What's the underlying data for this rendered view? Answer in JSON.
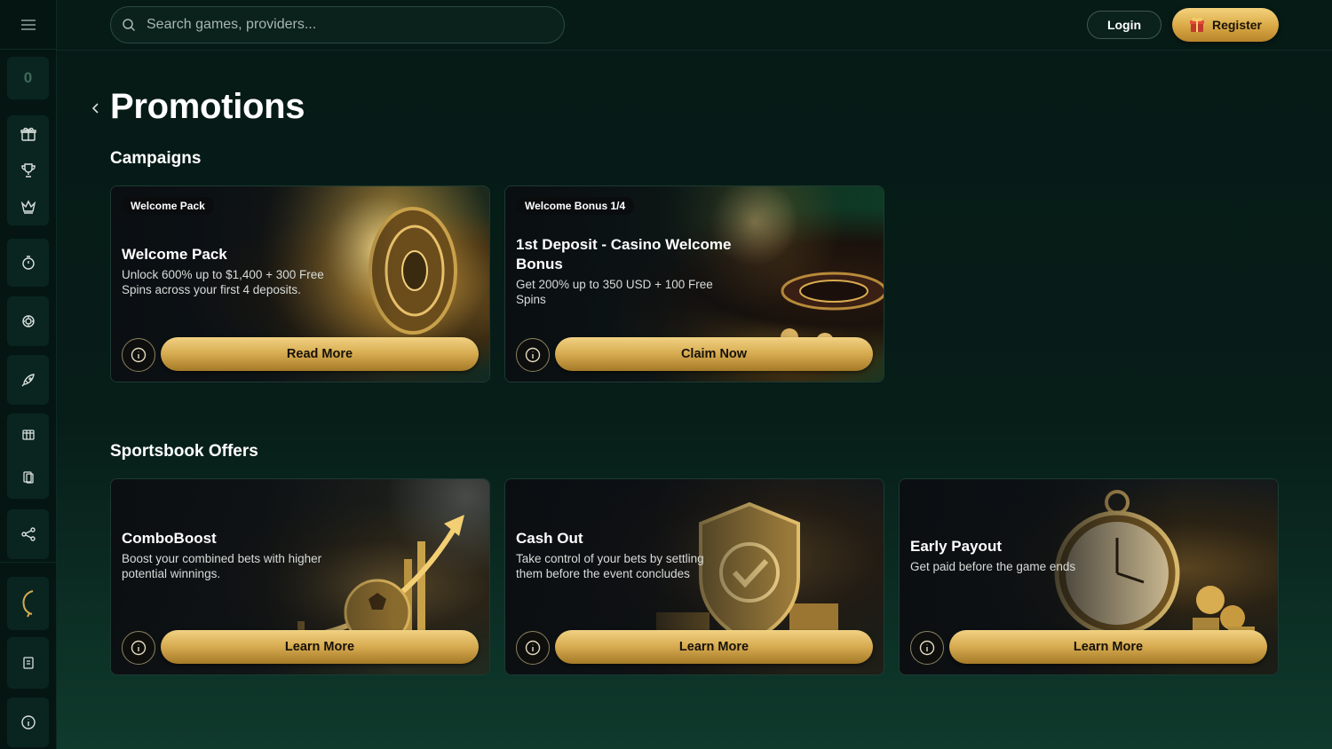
{
  "search": {
    "placeholder": "Search games, providers..."
  },
  "header": {
    "login_label": "Login",
    "register_label": "Register"
  },
  "sidebar": {
    "balance": "0"
  },
  "page": {
    "title": "Promotions"
  },
  "sections": {
    "campaigns": {
      "title": "Campaigns",
      "cards": [
        {
          "badge": "Welcome Pack",
          "title": "Welcome Pack",
          "description": "Unlock 600% up to $1,400 + 300 Free Spins across your first 4 deposits.",
          "cta": "Read More"
        },
        {
          "badge": "Welcome Bonus 1/4",
          "title": "1st Deposit - Casino Welcome Bonus",
          "description": "Get 200% up to 350 USD + 100 Free Spins",
          "cta": "Claim Now"
        }
      ]
    },
    "sportsbook": {
      "title": "Sportsbook Offers",
      "cards": [
        {
          "title": "ComboBoost",
          "description": "Boost your combined bets with higher potential winnings.",
          "cta": "Learn More"
        },
        {
          "title": "Cash Out",
          "description": "Take control of your bets by settling them before the event concludes",
          "cta": "Learn More"
        },
        {
          "title": "Early Payout",
          "description": "Get paid before the game ends",
          "cta": "Learn More"
        }
      ]
    }
  },
  "colors": {
    "background": "#061a16",
    "accent_gold": "#d6aa4f",
    "sidebar": "#051612"
  }
}
